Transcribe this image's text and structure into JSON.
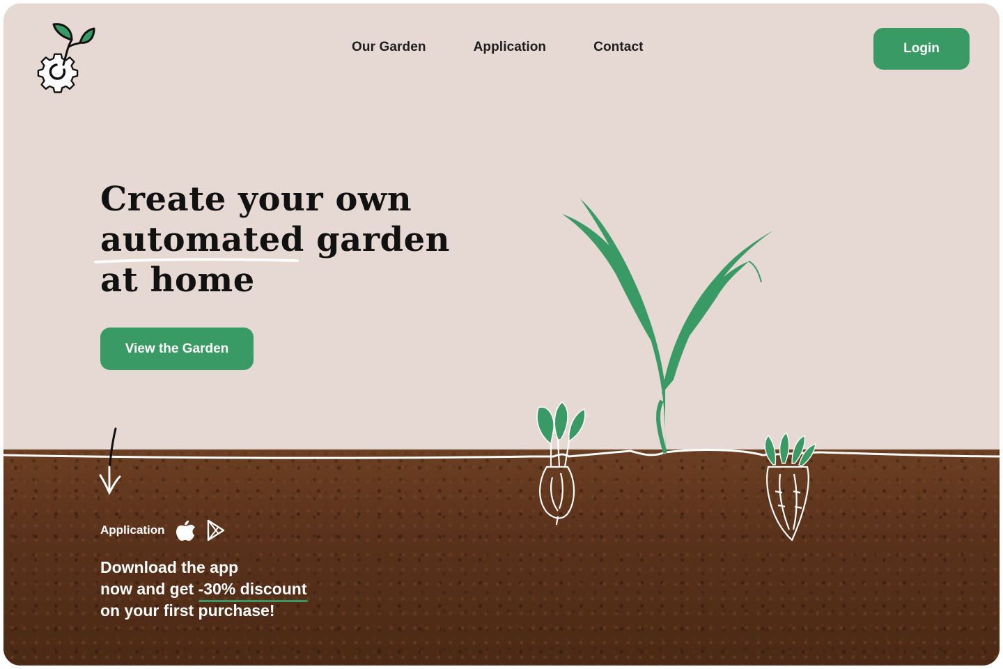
{
  "nav": {
    "items": [
      {
        "label": "Our Garden"
      },
      {
        "label": "Application"
      },
      {
        "label": "Contact"
      }
    ],
    "login_label": "Login"
  },
  "hero": {
    "title_line1": "Create your own",
    "title_line2": "automated garden",
    "title_line3": "at home",
    "cta_label": "View the Garden"
  },
  "app": {
    "label": "Application",
    "store_icons": [
      "apple-icon",
      "google-play-icon"
    ]
  },
  "promo": {
    "line1": "Download the app",
    "line2_prefix": "now and get ",
    "line2_highlight": "-30% discount",
    "line3": "on your first purchase!"
  },
  "colors": {
    "background": "#e6d8d2",
    "accent": "#3a9a65",
    "soil": "#5a321b",
    "text": "#111111"
  }
}
